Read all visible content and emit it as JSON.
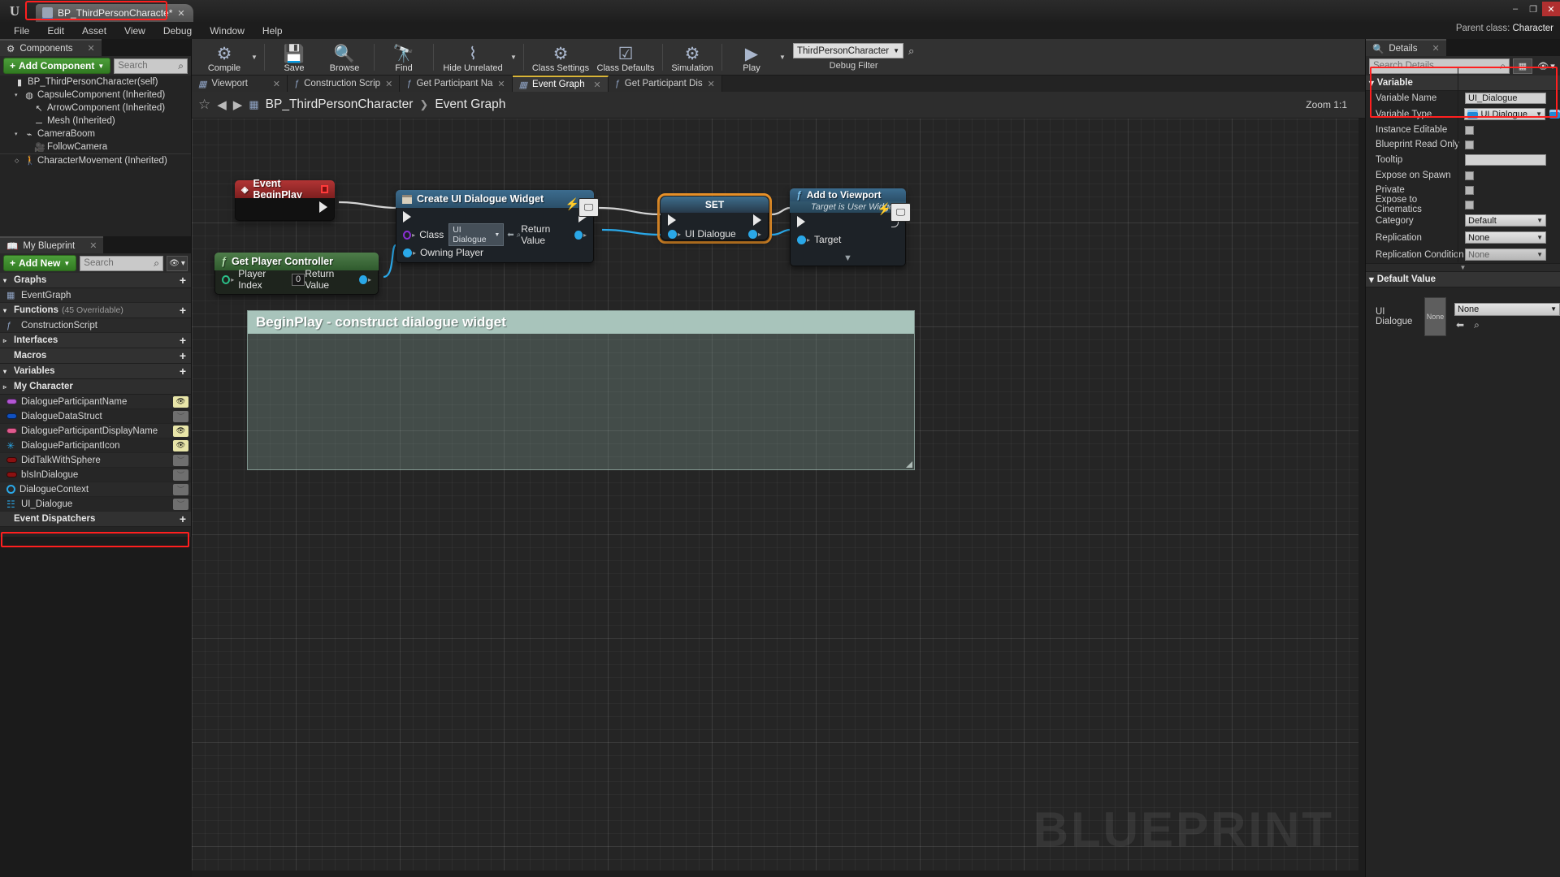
{
  "window": {
    "asset_tab_label": "BP_ThirdPersonCharacte*",
    "parent_class_label": "Parent class:",
    "parent_class_value": "Character",
    "min": "–",
    "max": "❐",
    "close": "✕"
  },
  "menu": {
    "items": [
      "File",
      "Edit",
      "Asset",
      "View",
      "Debug",
      "Window",
      "Help"
    ]
  },
  "components": {
    "tab_label": "Components",
    "add_button": "Add Component",
    "search_placeholder": "Search",
    "tree": [
      {
        "label": "BP_ThirdPersonCharacter(self)",
        "indent": 0,
        "arrow": "",
        "icon": "pawn-icon",
        "glyph": "▮"
      },
      {
        "label": "CapsuleComponent (Inherited)",
        "indent": 1,
        "arrow": "▾",
        "icon": "capsule-icon",
        "glyph": "◍"
      },
      {
        "label": "ArrowComponent (Inherited)",
        "indent": 2,
        "arrow": "",
        "icon": "arrow-icon",
        "glyph": "↖"
      },
      {
        "label": "Mesh (Inherited)",
        "indent": 2,
        "arrow": "",
        "icon": "mesh-icon",
        "glyph": "𝍠"
      },
      {
        "label": "CameraBoom",
        "indent": 1,
        "arrow": "▾",
        "icon": "spring-arm-icon",
        "glyph": "⌁"
      },
      {
        "label": "FollowCamera",
        "indent": 2,
        "arrow": "",
        "icon": "camera-icon",
        "glyph": "🎥"
      },
      {
        "label": "CharacterMovement (Inherited)",
        "indent": 1,
        "arrow": "◇",
        "icon": "movement-icon",
        "glyph": "🚶"
      }
    ]
  },
  "my_blueprint": {
    "tab_label": "My Blueprint",
    "add_button": "Add New",
    "search_placeholder": "Search",
    "sections": {
      "graphs": "Graphs",
      "functions": "Functions",
      "functions_sub": "(45 Overridable)",
      "interfaces": "Interfaces",
      "macros": "Macros",
      "variables": "Variables",
      "event_dispatchers": "Event Dispatchers"
    },
    "graphs_items": [
      {
        "label": "EventGraph",
        "icon": "graph-icon"
      }
    ],
    "functions_items": [
      {
        "label": "ConstructionScript",
        "icon": "function-icon"
      }
    ],
    "variable_category": "My Character",
    "variables": [
      {
        "label": "DialogueParticipantName",
        "color": "#b356d4",
        "shape": "pill",
        "eye": "on"
      },
      {
        "label": "DialogueDataStruct",
        "color": "#1050c0",
        "shape": "pill",
        "eye": "off"
      },
      {
        "label": "DialogueParticipantDisplayName",
        "color": "#e05a8e",
        "shape": "pill",
        "eye": "on"
      },
      {
        "label": "DialogueParticipantIcon",
        "color": "#2aa8e8",
        "shape": "star",
        "eye": "on"
      },
      {
        "label": "DidTalkWithSphere",
        "color": "#8b1111",
        "shape": "pill",
        "eye": "off"
      },
      {
        "label": "bIsInDialogue",
        "color": "#8b1111",
        "shape": "pill",
        "eye": "off"
      },
      {
        "label": "DialogueContext",
        "color": "#2aa8e8",
        "shape": "circle",
        "eye": "off"
      },
      {
        "label": "UI_Dialogue",
        "color": "#2aa8e8",
        "shape": "widget",
        "eye": "off"
      }
    ],
    "selected_variable_index": 7
  },
  "toolbar": {
    "items": [
      {
        "label": "Compile",
        "icon": "compile-gears-icon",
        "glyph": "⚙",
        "caret": true
      },
      {
        "label": "Save",
        "icon": "save-floppy-icon",
        "glyph": "💾",
        "caret": false
      },
      {
        "label": "Browse",
        "icon": "browse-magnifier-icon",
        "glyph": "🔍",
        "caret": false
      },
      {
        "label": "Find",
        "icon": "find-binoculars-icon",
        "glyph": "🔭",
        "caret": false
      },
      {
        "label": "Hide Unrelated",
        "icon": "hide-unrelated-nodes-icon",
        "glyph": "⌇",
        "caret": true
      },
      {
        "label": "Class Settings",
        "icon": "class-settings-icon",
        "glyph": "⚙",
        "caret": false
      },
      {
        "label": "Class Defaults",
        "icon": "class-defaults-icon",
        "glyph": "☑",
        "caret": false
      },
      {
        "label": "Simulation",
        "icon": "simulation-icon",
        "glyph": "⚙",
        "caret": false
      },
      {
        "label": "Play",
        "icon": "play-icon",
        "glyph": "▶",
        "caret": true
      }
    ],
    "debug_filter_value": "ThirdPersonCharacter",
    "debug_filter_label": "Debug Filter"
  },
  "graph_tabs": [
    {
      "label": "Viewport",
      "icon": "viewport-icon",
      "active": false
    },
    {
      "label": "Construction Scrip",
      "icon": "function-icon",
      "active": false
    },
    {
      "label": "Get Participant Na",
      "icon": "function-icon",
      "active": false
    },
    {
      "label": "Event Graph",
      "icon": "graph-icon",
      "active": true
    },
    {
      "label": "Get Participant Dis",
      "icon": "function-icon",
      "active": false
    }
  ],
  "breadcrumb": {
    "root": "BP_ThirdPersonCharacter",
    "separator": "❯",
    "current": "Event Graph",
    "zoom": "Zoom 1:1"
  },
  "graph": {
    "watermark": "BLUEPRINT",
    "comment_title": "BeginPlay - construct dialogue widget",
    "nodes": {
      "event_begin_play": {
        "title": "Event BeginPlay",
        "icon": "event-diamond-icon"
      },
      "create_widget": {
        "title": "Create UI Dialogue Widget",
        "icon": "widget-icon",
        "pin_class": "Class",
        "class_value": "UI Dialogue",
        "pin_owning_player": "Owning Player",
        "pin_return": "Return Value",
        "badge": "monitor-icon"
      },
      "get_player_controller": {
        "title": "Get Player Controller",
        "icon": "function-icon",
        "pin_player_index": "Player Index",
        "player_index_value": "0",
        "pin_return": "Return Value"
      },
      "set_node": {
        "title": "SET",
        "pin_value": "UI Dialogue"
      },
      "add_to_viewport": {
        "title": "Add to Viewport",
        "subtitle": "Target is User Widget",
        "icon": "function-icon",
        "pin_target": "Target",
        "badge": "monitor-icon"
      }
    }
  },
  "details": {
    "tab_label": "Details",
    "search_placeholder": "Search Details",
    "section_variable": "Variable",
    "section_default_value": "Default Value",
    "rows": [
      {
        "label": "Variable Name",
        "type": "text",
        "value": "UI_Dialogue"
      },
      {
        "label": "Variable Type",
        "type": "typecombo",
        "value": "UI Dialogue"
      },
      {
        "label": "Instance Editable",
        "type": "checkbox",
        "value": ""
      },
      {
        "label": "Blueprint Read Only",
        "type": "checkbox",
        "value": ""
      },
      {
        "label": "Tooltip",
        "type": "text",
        "value": ""
      },
      {
        "label": "Expose on Spawn",
        "type": "checkbox",
        "value": ""
      },
      {
        "label": "Private",
        "type": "checkbox",
        "value": ""
      },
      {
        "label": "Expose to Cinematics",
        "type": "checkbox",
        "value": ""
      },
      {
        "label": "Category",
        "type": "combo",
        "value": "Default"
      },
      {
        "label": "Replication",
        "type": "combo",
        "value": "None"
      },
      {
        "label": "Replication Condition",
        "type": "combo-disabled",
        "value": "None"
      }
    ],
    "default_value": {
      "label": "UI Dialogue",
      "thumbnail_text": "None",
      "combo_value": "None"
    }
  }
}
